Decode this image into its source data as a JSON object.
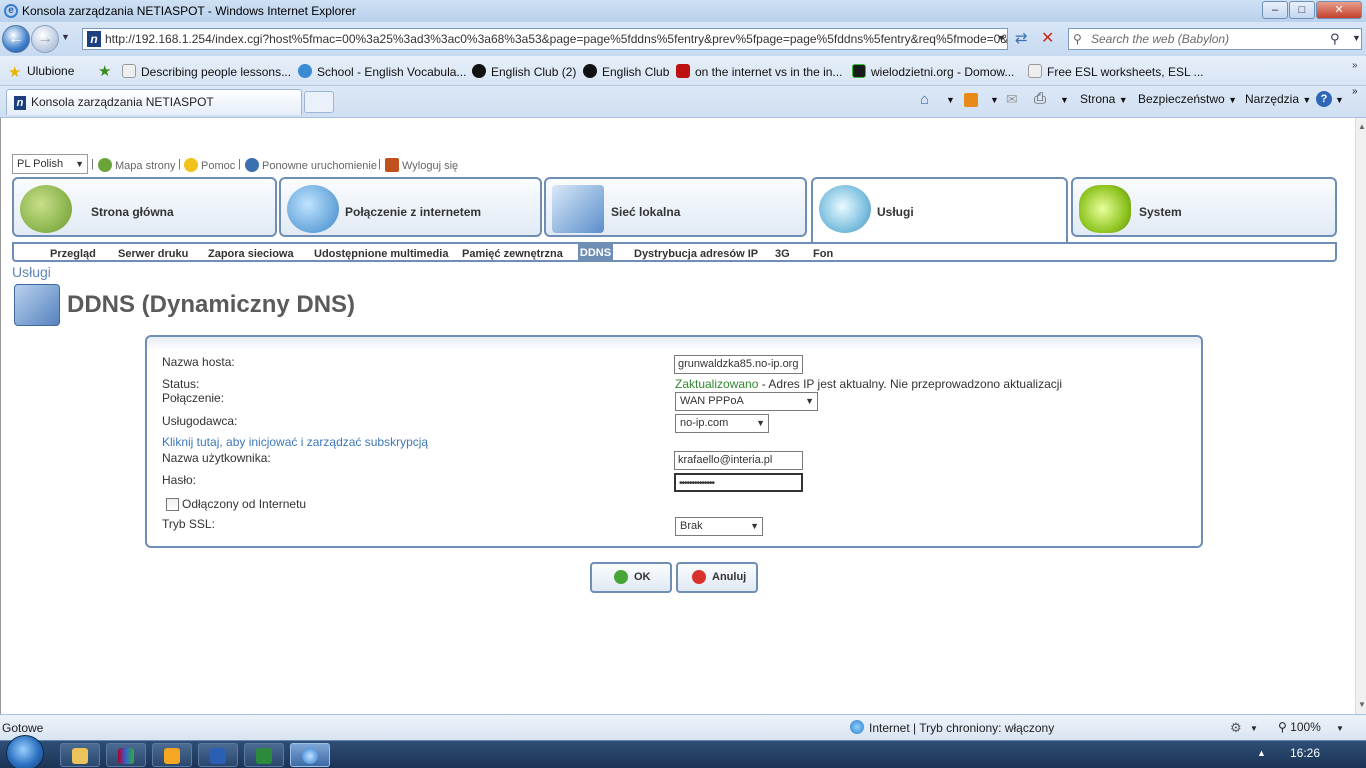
{
  "window": {
    "title": "Konsola zarządzania NETIASPOT - Windows Internet Explorer",
    "minimize": "–",
    "maximize": "□",
    "close": "✕"
  },
  "browser": {
    "address": "http://192.168.1.254/index.cgi?host%5fmac=00%3a25%3ad3%3ac0%3a68%3a53&page=page%5fddns%5fentry&prev%5fpage=page%5fddns%5fentry&req%5fmode=0&mimic%",
    "search_placeholder": "Search the web (Babylon)",
    "favorites_label": "Ulubione",
    "favorites": [
      "Describing people lessons...",
      "School - English Vocabula...",
      "English Club (2)",
      "English Club",
      "on the internet vs in the in...",
      "wielodzietni.org - Domow...",
      "Free ESL worksheets, ESL ..."
    ],
    "tab_title": "Konsola zarządzania NETIASPOT",
    "commands": {
      "page": "Strona",
      "safety": "Bezpieczeństwo",
      "tools": "Narzędzia"
    },
    "status_left": "Gotowe",
    "status_zone": "Internet | Tryb chroniony: włączony",
    "zoom": "100%",
    "clock": "16:26"
  },
  "router": {
    "language": "PL Polish",
    "links": {
      "sitemap": "Mapa strony",
      "help": "Pomoc",
      "restart": "Ponowne uruchomienie",
      "logout": "Wyloguj się"
    },
    "main_nav": [
      "Strona główna",
      "Połączenie z internetem",
      "Sieć lokalna",
      "Usługi",
      "System"
    ],
    "sub_nav": [
      "Przegląd",
      "Serwer druku",
      "Zapora sieciowa",
      "Udostępnione multimedia",
      "Pamięć zewnętrzna",
      "DDNS",
      "Dystrybucja adresów IP",
      "3G",
      "Fon"
    ],
    "breadcrumb": "Usługi",
    "page_title": "DDNS (Dynamiczny DNS)",
    "form": {
      "host_label": "Nazwa hosta:",
      "host_value": "grunwaldzka85.no-ip.org",
      "status_label": "Status:",
      "status_ok": "Zaktualizowano",
      "status_msg": " - Adres IP jest aktualny. Nie przeprowadzono aktualizacji",
      "connection_label": "Połączenie:",
      "connection_value": "WAN PPPoA",
      "provider_label": "Usługodawca:",
      "provider_value": "no-ip.com",
      "subscribe_link": "Kliknij tutaj, aby inicjować i zarządzać subskrypcją",
      "user_label": "Nazwa użytkownika:",
      "user_value": "krafaello@interia.pl",
      "password_label": "Hasło:",
      "password_value": "••••••••••••••",
      "offline_label": "Odłączony od Internetu",
      "ssl_label": "Tryb SSL:",
      "ssl_value": "Brak"
    },
    "ok_button": "OK",
    "cancel_button": "Anuluj"
  }
}
